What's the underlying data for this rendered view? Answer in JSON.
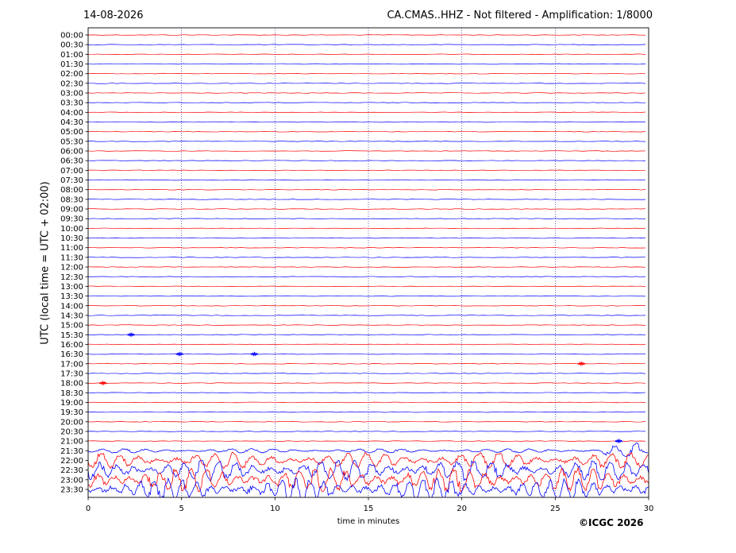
{
  "header": {
    "date": "14-08-2026",
    "station_title": "CA.CMAS..HHZ - Not filtered - Amplification: 1/8000"
  },
  "footer": {
    "copyright": "©ICGC 2026"
  },
  "chart_data": {
    "type": "line",
    "title": "CA.CMAS..HHZ - Not filtered - Amplification: 1/8000",
    "date": "14-08-2026",
    "xlabel": "time in minutes",
    "ylabel": "UTC (local time = UTC + 02:00)",
    "xlim": [
      0,
      30
    ],
    "xticks": [
      0,
      5,
      10,
      15,
      20,
      25,
      30
    ],
    "x_grid": "dotted vertical lines every 5 minutes",
    "row_labels": [
      "00:00",
      "00:30",
      "01:00",
      "01:30",
      "02:00",
      "02:30",
      "03:00",
      "03:30",
      "04:00",
      "04:30",
      "05:00",
      "05:30",
      "06:00",
      "06:30",
      "07:00",
      "07:30",
      "08:00",
      "08:30",
      "09:00",
      "09:30",
      "10:00",
      "10:30",
      "11:00",
      "11:30",
      "12:00",
      "12:30",
      "13:00",
      "13:30",
      "14:00",
      "14:30",
      "15:00",
      "15:30",
      "16:00",
      "16:30",
      "17:00",
      "17:30",
      "18:00",
      "18:30",
      "19:00",
      "19:30",
      "20:00",
      "20:30",
      "21:00",
      "21:30",
      "22:00",
      "22:30",
      "23:00",
      "23:30"
    ],
    "trace_colors": [
      "#ff0000",
      "#0000ff"
    ],
    "color_rule": "rows alternate red (hh:00) and blue (hh:30)",
    "events": [
      {
        "row": "15:30",
        "minute": 2.3,
        "color": "#0000ff"
      },
      {
        "row": "16:30",
        "minute": 4.9,
        "color": "#0000ff"
      },
      {
        "row": "16:30",
        "minute": 8.9,
        "color": "#0000ff"
      },
      {
        "row": "17:00",
        "minute": 26.4,
        "color": "#ff0000"
      },
      {
        "row": "18:00",
        "minute": 0.8,
        "color": "#ff0000"
      },
      {
        "row": "21:00",
        "minute": 28.4,
        "color": "#0000ff"
      }
    ],
    "strong_motion_rows": [
      "21:30",
      "22:00",
      "22:30",
      "23:00",
      "23:30"
    ]
  }
}
